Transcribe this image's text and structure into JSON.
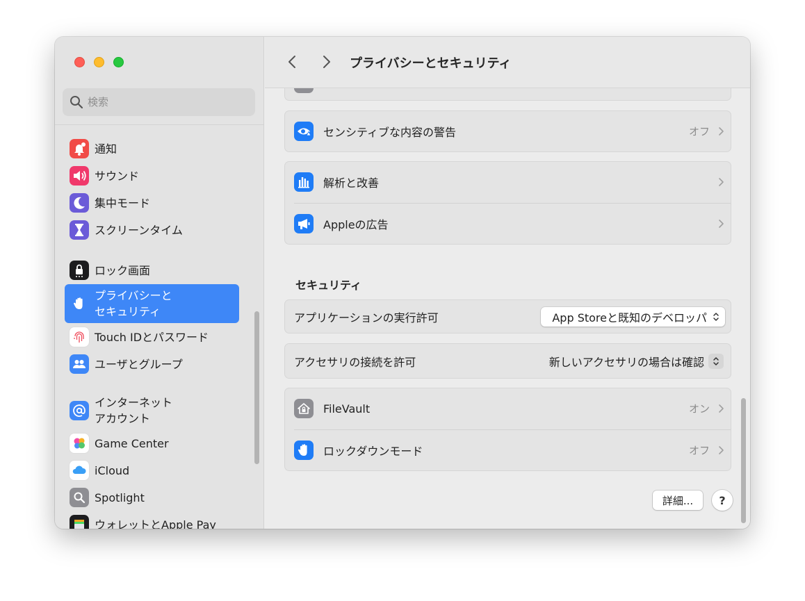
{
  "window": {
    "title": "プライバシーとセキュリティ"
  },
  "sidebar": {
    "search_placeholder": "検索",
    "items": [
      {
        "label": "通知",
        "icon": "bell-icon",
        "color": "#f14b47"
      },
      {
        "label": "サウンド",
        "icon": "speaker-icon",
        "color": "#f0396b"
      },
      {
        "label": "集中モード",
        "icon": "moon-icon",
        "color": "#6b5bd8"
      },
      {
        "label": "スクリーンタイム",
        "icon": "hourglass-icon",
        "color": "#6b5bd8"
      },
      {
        "label": "ロック画面",
        "icon": "lock-screen-icon",
        "color": "#1c1c1e"
      },
      {
        "label_line1": "プライバシーと",
        "label_line2": "セキュリティ",
        "icon": "hand-icon",
        "color": "#3e87f7",
        "selected": true
      },
      {
        "label": "Touch IDとパスワード",
        "icon": "fingerprint-icon",
        "color": "#ffffff"
      },
      {
        "label": "ユーザとグループ",
        "icon": "users-icon",
        "color": "#3e87f7"
      },
      {
        "label_line1": "インターネット",
        "label_line2": "アカウント",
        "icon": "at-sign-icon",
        "color": "#3e87f7"
      },
      {
        "label": "Game Center",
        "icon": "game-center-icon",
        "color": "#ffffff"
      },
      {
        "label": "iCloud",
        "icon": "cloud-icon",
        "color": "#ffffff"
      },
      {
        "label": "Spotlight",
        "icon": "magnifier-icon",
        "color": "#8e8e93"
      },
      {
        "label": "ウォレットとApple Pay",
        "icon": "wallet-icon",
        "color": "#1c1c1e"
      }
    ]
  },
  "main": {
    "privacy_rows": [
      {
        "label": "センシティブな内容の警告",
        "value": "オフ",
        "icon": "eye-warning-icon"
      },
      {
        "label": "解析と改善",
        "value": "",
        "icon": "chart-bars-icon"
      },
      {
        "label": "Appleの広告",
        "value": "",
        "icon": "megaphone-icon"
      }
    ],
    "security_title": "セキュリティ",
    "security": {
      "app_execution": {
        "label": "アプリケーションの実行許可",
        "value": "App Storeと既知のデベロッパ"
      },
      "accessory": {
        "label": "アクセサリの接続を許可",
        "value": "新しいアクセサリの場合は確認"
      },
      "filevault": {
        "label": "FileVault",
        "value": "オン",
        "icon": "house-lock-icon"
      },
      "lockdown": {
        "label": "ロックダウンモード",
        "value": "オフ",
        "icon": "hand-icon"
      }
    },
    "details_label": "詳細...",
    "help_label": "?"
  }
}
